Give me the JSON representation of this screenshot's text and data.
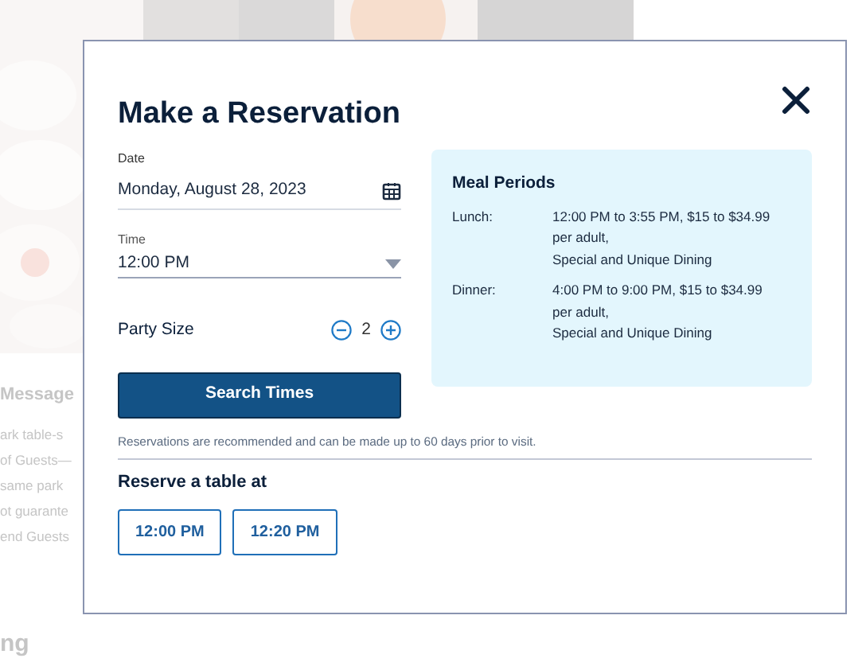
{
  "background": {
    "heading": "Message",
    "lines": [
      "ark table-s",
      "of Guests—",
      "same park",
      "ot guarante",
      "end Guests"
    ],
    "footer_heading": "ng"
  },
  "dialog": {
    "title": "Make a Reservation",
    "date": {
      "label": "Date",
      "value": "Monday, August 28, 2023"
    },
    "time": {
      "label": "Time",
      "value": "12:00 PM"
    },
    "party_size": {
      "label": "Party Size",
      "value": "2"
    },
    "search_button": "Search Times",
    "meal_periods": {
      "title": "Meal Periods",
      "rows": [
        {
          "name": "Lunch:",
          "lines": [
            "12:00 PM to 3:55 PM, $15 to $34.99",
            "per adult,",
            "Special and Unique Dining"
          ]
        },
        {
          "name": "Dinner:",
          "lines": [
            "4:00 PM to 9:00 PM, $15 to $34.99",
            "per adult,",
            "Special and Unique Dining"
          ]
        }
      ]
    },
    "note": "Reservations are recommended and can be made up to 60 days prior to visit.",
    "reserve_heading": "Reserve a table at",
    "times": [
      {
        "label": "12:00 PM"
      },
      {
        "label": "12:20 PM"
      }
    ]
  }
}
